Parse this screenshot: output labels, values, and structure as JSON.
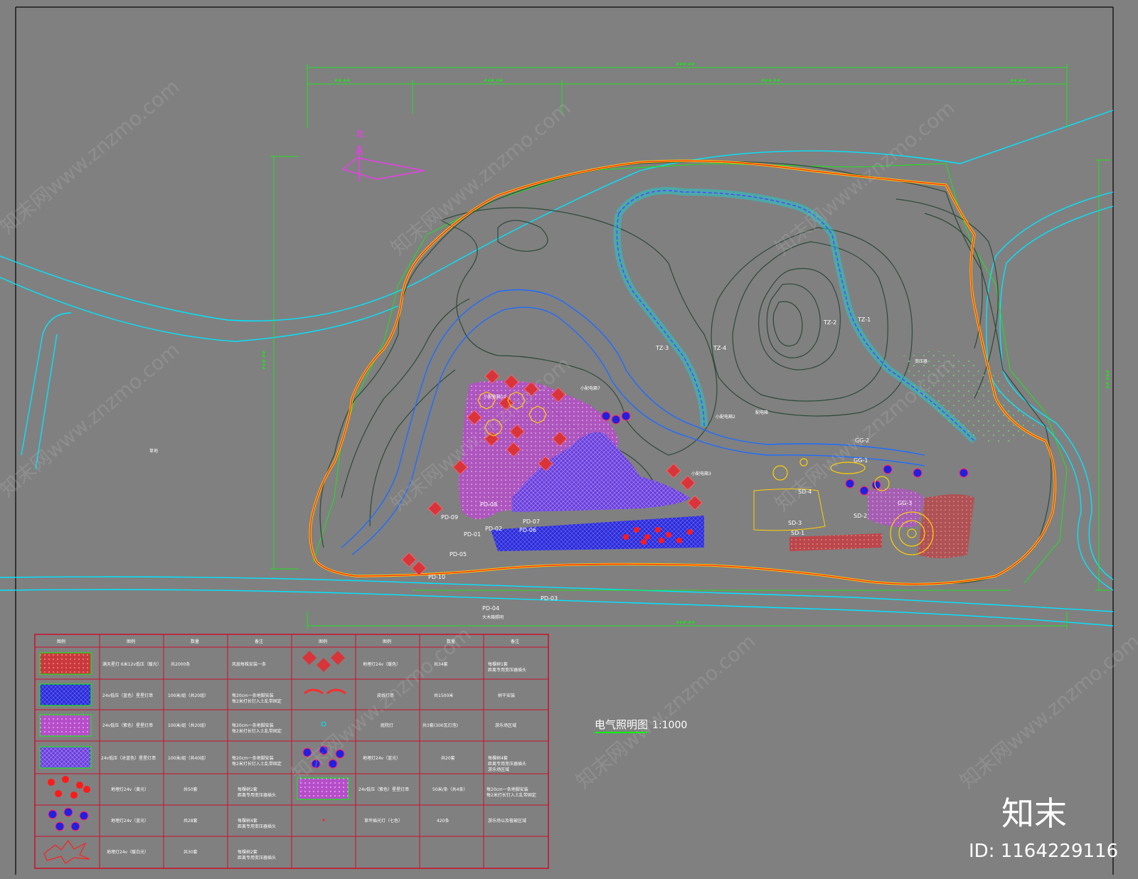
{
  "drawing": {
    "north_label": "北",
    "title": "电气照明图",
    "scale": "1:1000",
    "road_label_left": "草地",
    "labels": [
      {
        "id": "tz1",
        "text": "TZ-1"
      },
      {
        "id": "tz2",
        "text": "TZ-2"
      },
      {
        "id": "tz3",
        "text": "TZ-3"
      },
      {
        "id": "tz4",
        "text": "TZ-4"
      },
      {
        "id": "gg1",
        "text": "GG-1"
      },
      {
        "id": "gg2",
        "text": "GG-2"
      },
      {
        "id": "gg3",
        "text": "GG-3"
      },
      {
        "id": "sd1",
        "text": "SD-1"
      },
      {
        "id": "sd2",
        "text": "SD-2"
      },
      {
        "id": "sd3",
        "text": "SD-3"
      },
      {
        "id": "sd4",
        "text": "SD-4"
      },
      {
        "id": "pd01",
        "text": "PD-01"
      },
      {
        "id": "pd02",
        "text": "PD-02"
      },
      {
        "id": "pd03",
        "text": "PD-03"
      },
      {
        "id": "pd04",
        "text": "PD-04"
      },
      {
        "id": "pd05",
        "text": "PD-05"
      },
      {
        "id": "pd06",
        "text": "PD-06"
      },
      {
        "id": "pd07",
        "text": "PD-07"
      },
      {
        "id": "pd08",
        "text": "PD-08"
      },
      {
        "id": "pd09",
        "text": "PD-09"
      },
      {
        "id": "pd10",
        "text": "PD-10"
      },
      {
        "id": "xdx2",
        "text": "小配电箱2"
      },
      {
        "id": "xdx3",
        "text": "小配电箱3"
      },
      {
        "id": "xdx7",
        "text": "小配电箱7"
      },
      {
        "id": "xdx10",
        "text": "小配电箱10"
      },
      {
        "id": "byq",
        "text": "变压器"
      },
      {
        "id": "ppd",
        "text": "配电箱"
      }
    ],
    "pd04_note": "大木箱照明"
  },
  "legend": {
    "headers": [
      "图例",
      "图例",
      "数量",
      "备注",
      "图例",
      "图例",
      "数量",
      "备注"
    ],
    "rows": [
      {
        "l_name": "满天星灯 6米12v低压（暖光）",
        "l_qty": "共2000条",
        "l_note": "风扇每株安装一条",
        "r_name": "地埋灯24v（暖色）",
        "r_qty": "共34套",
        "r_note": "每棵树1套\n距离专用变压器插头"
      },
      {
        "l_name": "24v低压（蓝色）星星灯串",
        "l_qty": "100米/组（共20组）",
        "l_note": "每20cm一条地脚安装\n每2米打长钉入土乱带固定",
        "r_name": "皮线灯串",
        "r_qty": "共1500米",
        "r_note": "树干安装"
      },
      {
        "l_name": "24v低压（紫色）星星灯串",
        "l_qty": "100米/组（共20组）",
        "l_note": "每20cm一条地脚安装\n每2米打长钉入土乱带固定",
        "r_name": "庭院灯",
        "r_qty": "共3套(300瓦灯泡)",
        "r_note": "游乐场区域"
      },
      {
        "l_name": "24v低压（冰蓝色）星星灯串",
        "l_qty": "100米/组（共40组）",
        "l_note": "每20cm一条地脚安装\n每2米打长钉入土乱带固定",
        "r_name": "地埋灯24v（蓝光）",
        "r_qty": "共20套",
        "r_note": "每棵树4套\n距离专用变压器插头\n游乐场区域"
      },
      {
        "l_name": "地埋灯24v（黄光）",
        "l_qty": "共50套",
        "l_note": "每棵树2套\n距离专用变压器插头",
        "r_name": "24v低压（紫色）星星灯串",
        "r_qty": "50米/条（共4条）",
        "r_note": "每20cm一条地脚安装\n每2米打长钉入土乱带固定"
      },
      {
        "l_name": "地埋灯24v（蓝光）",
        "l_qty": "共28套",
        "l_note": "每棵树4套\n距离专用变压器插头",
        "r_name": "草坪插光灯（七色）",
        "r_qty": "420条",
        "r_note": "游乐场以及植被区域"
      },
      {
        "l_name": "地埋灯24v（暖白光）",
        "l_qty": "共30套",
        "l_note": "每棵树2套\n距离专用变压器插头",
        "r_name": "",
        "r_qty": "",
        "r_note": ""
      }
    ]
  },
  "watermark": {
    "text": "知末网www.znzmo.com",
    "brand": "知末",
    "id": "ID: 1164229116"
  },
  "colors": {
    "background": "#808080",
    "boundary_red": "#ff2020",
    "boundary_yellow": "#ffd000",
    "road_cyan": "#00e5ff",
    "contour_dark": "#2e4a3a",
    "water_blue": "#1e6cff",
    "legend_border": "#c8102e",
    "dimension_green": "#00ff00"
  }
}
